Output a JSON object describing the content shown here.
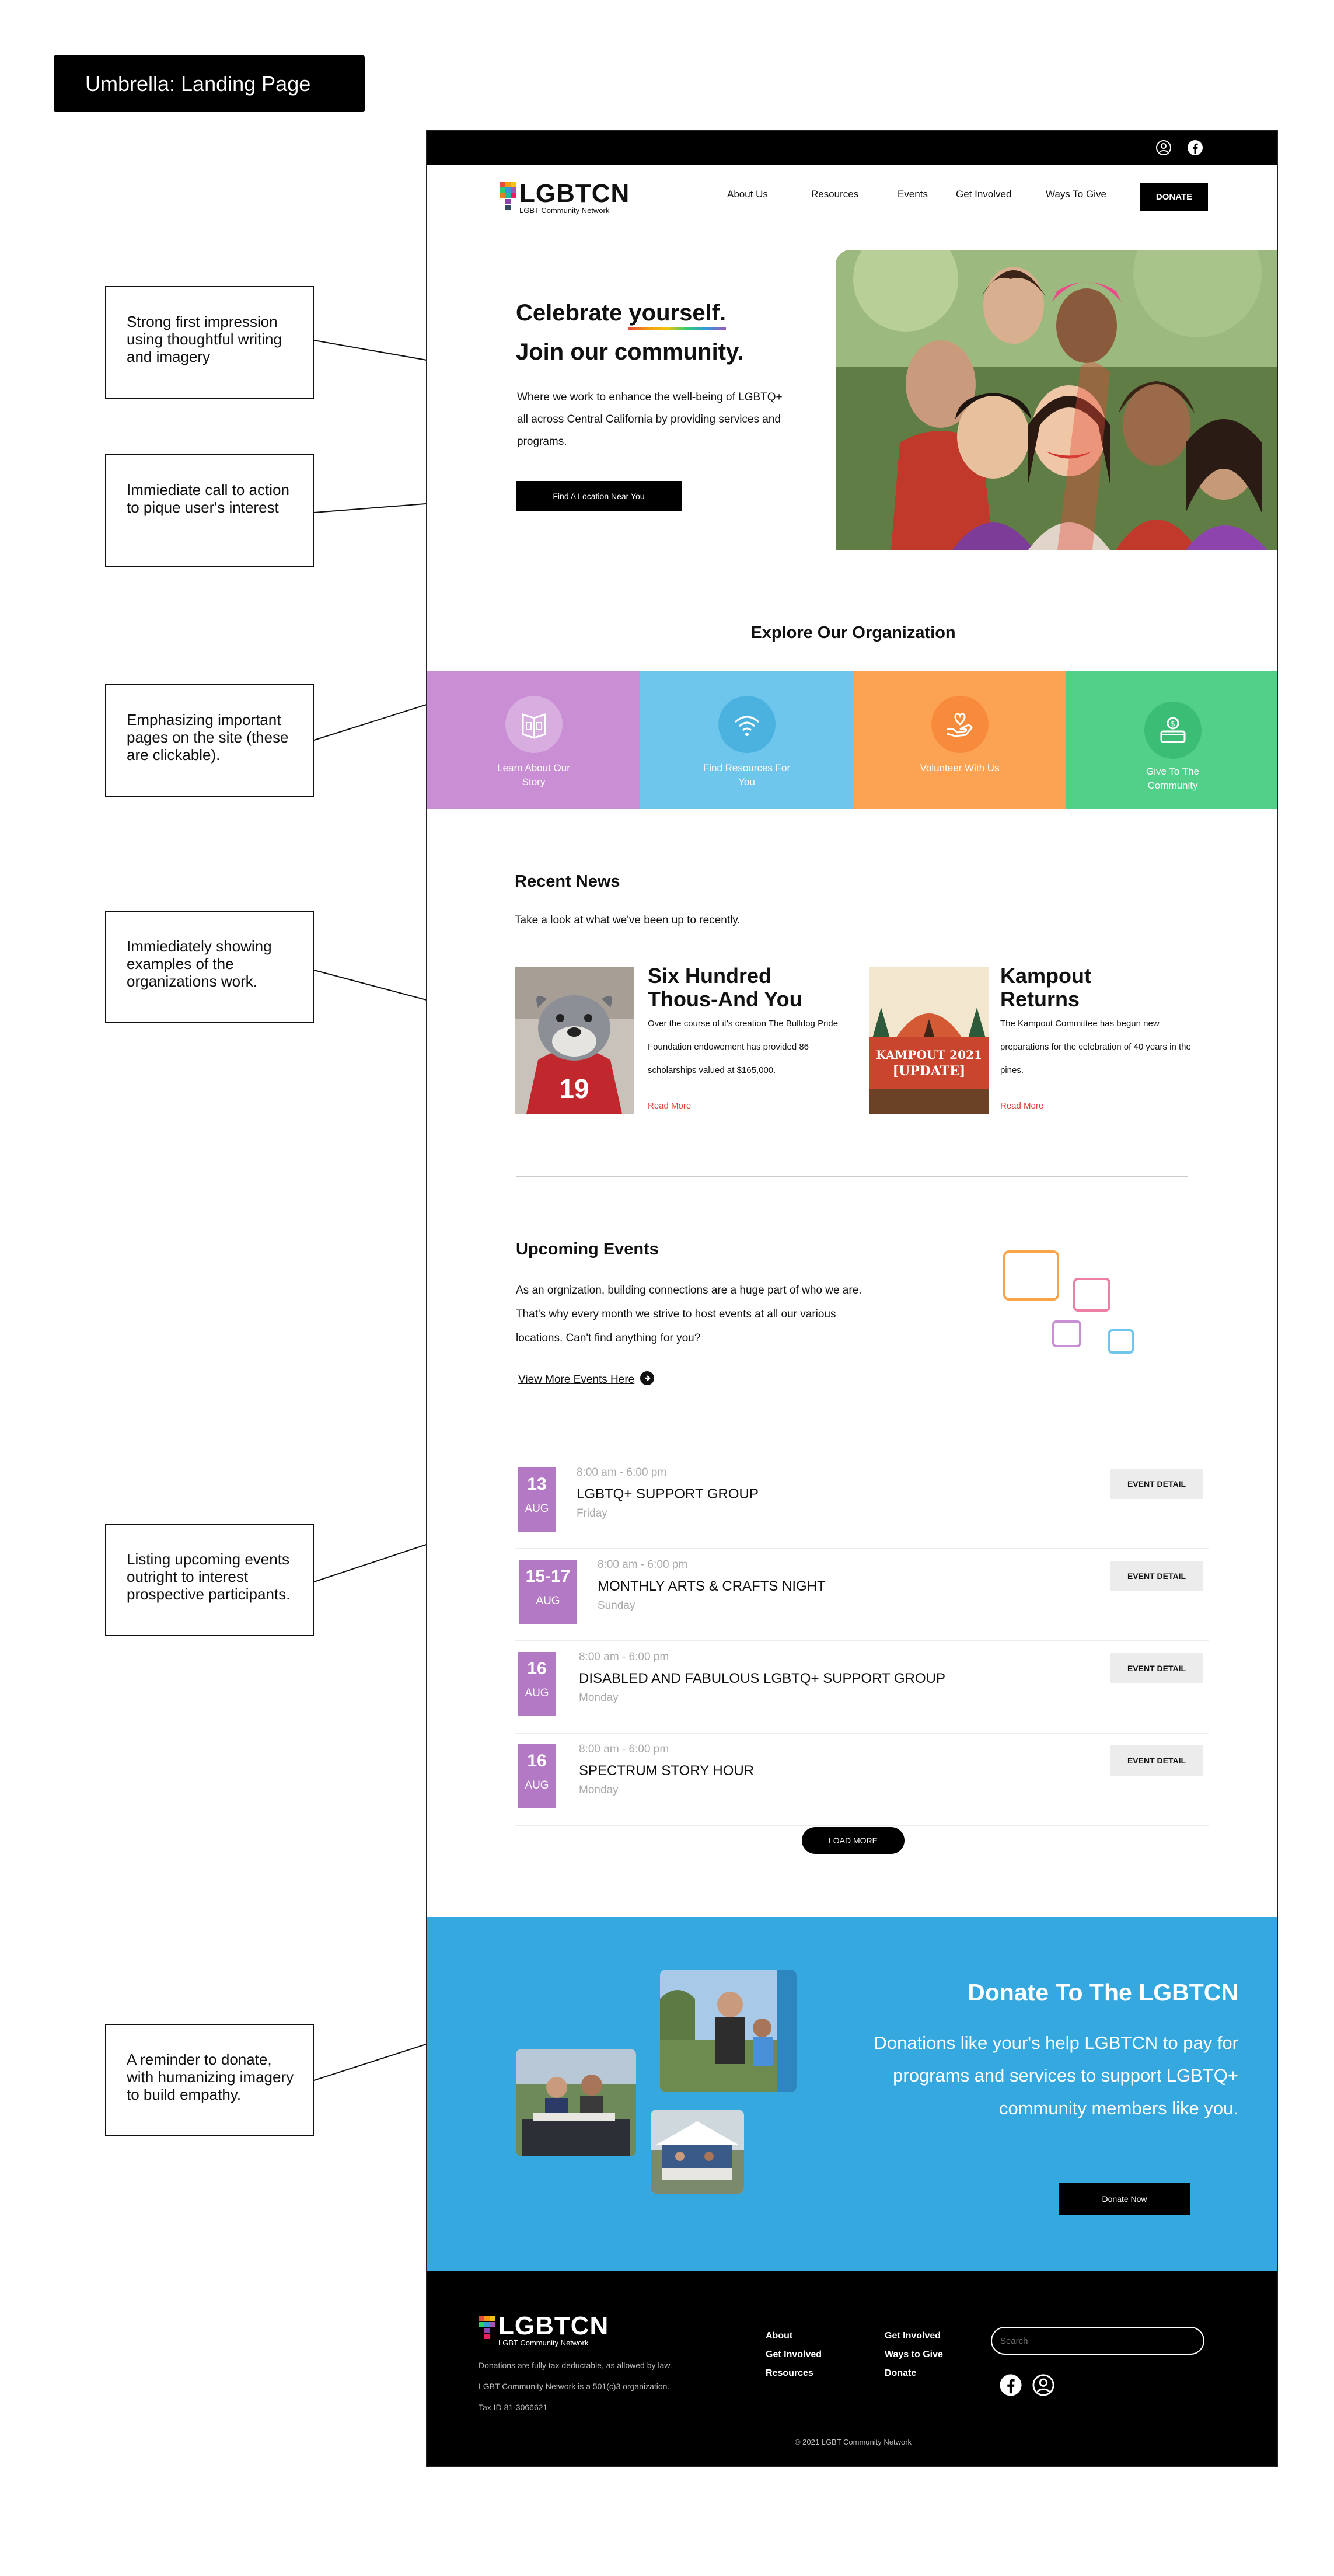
{
  "doc_title": "Umbrella: Landing Page",
  "annotations": [
    "Strong first impression using thoughtful writing and imagery",
    "Immiediate call to action to pique user's interest",
    "Emphasizing important pages on the site (these are clickable).",
    "Immiediately showing examples of the organizations work.",
    "Listing upcoming events outright to interest prospective participants.",
    "A reminder to donate, with humanizing imagery to build empathy."
  ],
  "brand": {
    "name": "LGBTCN",
    "tagline": "LGBT Community Network"
  },
  "nav": {
    "items": [
      "About Us",
      "Resources",
      "Events",
      "Get Involved",
      "Ways To Give"
    ],
    "donate": "DONATE"
  },
  "hero": {
    "line1_a": "Celebrate ",
    "line1_b": "yourself.",
    "line2": "Join our community.",
    "body": "Where we work to enhance the well-being of LGBTQ+ all across Central California by providing services and programs.",
    "cta": "Find A Location Near You"
  },
  "explore": {
    "title": "Explore Our Organization",
    "tiles": [
      {
        "label": "Learn About Our Story",
        "icon": "book-icon",
        "color": "#c98ed4"
      },
      {
        "label": "Find Resources For You",
        "icon": "wifi-icon",
        "color": "#6ec6ec"
      },
      {
        "label": "Volunteer With Us",
        "icon": "heart-hand-icon",
        "color": "#fba352"
      },
      {
        "label": "Give To The Community",
        "icon": "money-icon",
        "color": "#52d08a"
      }
    ]
  },
  "news": {
    "title": "Recent News",
    "subtitle": "Take a look at what we've been up to recently.",
    "items": [
      {
        "title": "Six Hundred Thous-And You",
        "body": "Over the course of it's creation The Bulldog Pride Foundation endowement has provided 86 scholarships valued at $165,000.",
        "link": "Read More"
      },
      {
        "title": "Kampout Returns",
        "body": "The Kampout Committee has begun new preparations for the celebration of 40 years in the pines.",
        "link": "Read More",
        "image_text_1": "KAMPOUT 2021",
        "image_text_2": "[UPDATE]"
      }
    ]
  },
  "events_intro": {
    "title": "Upcoming Events",
    "body": "As an orgnization, building connections are a huge part of who we are. That's why every month we strive to host  events at all our various locations. Can't find anything for you?",
    "link": "View More Events Here"
  },
  "events": [
    {
      "day": "13",
      "month": "AUG",
      "time": "8:00 am - 6:00 pm",
      "title": "LGBTQ+ SUPPORT GROUP",
      "dow": "Friday",
      "button": "EVENT DETAIL"
    },
    {
      "day": "15-17",
      "month": "AUG",
      "time": "8:00 am - 6:00 pm",
      "title": "MONTHLY ARTS & CRAFTS NIGHT",
      "dow": "Sunday",
      "button": "EVENT DETAIL"
    },
    {
      "day": "16",
      "month": "AUG",
      "time": "8:00 am - 6:00 pm",
      "title": "DISABLED AND FABULOUS LGBTQ+ SUPPORT GROUP",
      "dow": "Monday",
      "button": "EVENT DETAIL"
    },
    {
      "day": "16",
      "month": "AUG",
      "time": "8:00 am - 6:00 pm",
      "title": "SPECTRUM STORY HOUR",
      "dow": "Monday",
      "button": "EVENT DETAIL"
    }
  ],
  "load_more": "LOAD MORE",
  "donate": {
    "title": "Donate To The LGBTCN",
    "body": "Donations like your's help LGBTCN to pay for programs and services to support LGBTQ+ community members like you.",
    "cta": "Donate Now"
  },
  "footer": {
    "desc": [
      "Donations are fully tax deductable, as allowed by law.",
      "LGBT Community Network is a 501(c)3 organization.",
      "Tax ID 81-3066621"
    ],
    "col1": [
      "About",
      "Get Involved",
      "Resources"
    ],
    "col2": [
      "Get Involved",
      "Ways to Give",
      "Donate"
    ],
    "search_placeholder": "Search",
    "copyright": "© 2021 LGBT Community Network"
  }
}
